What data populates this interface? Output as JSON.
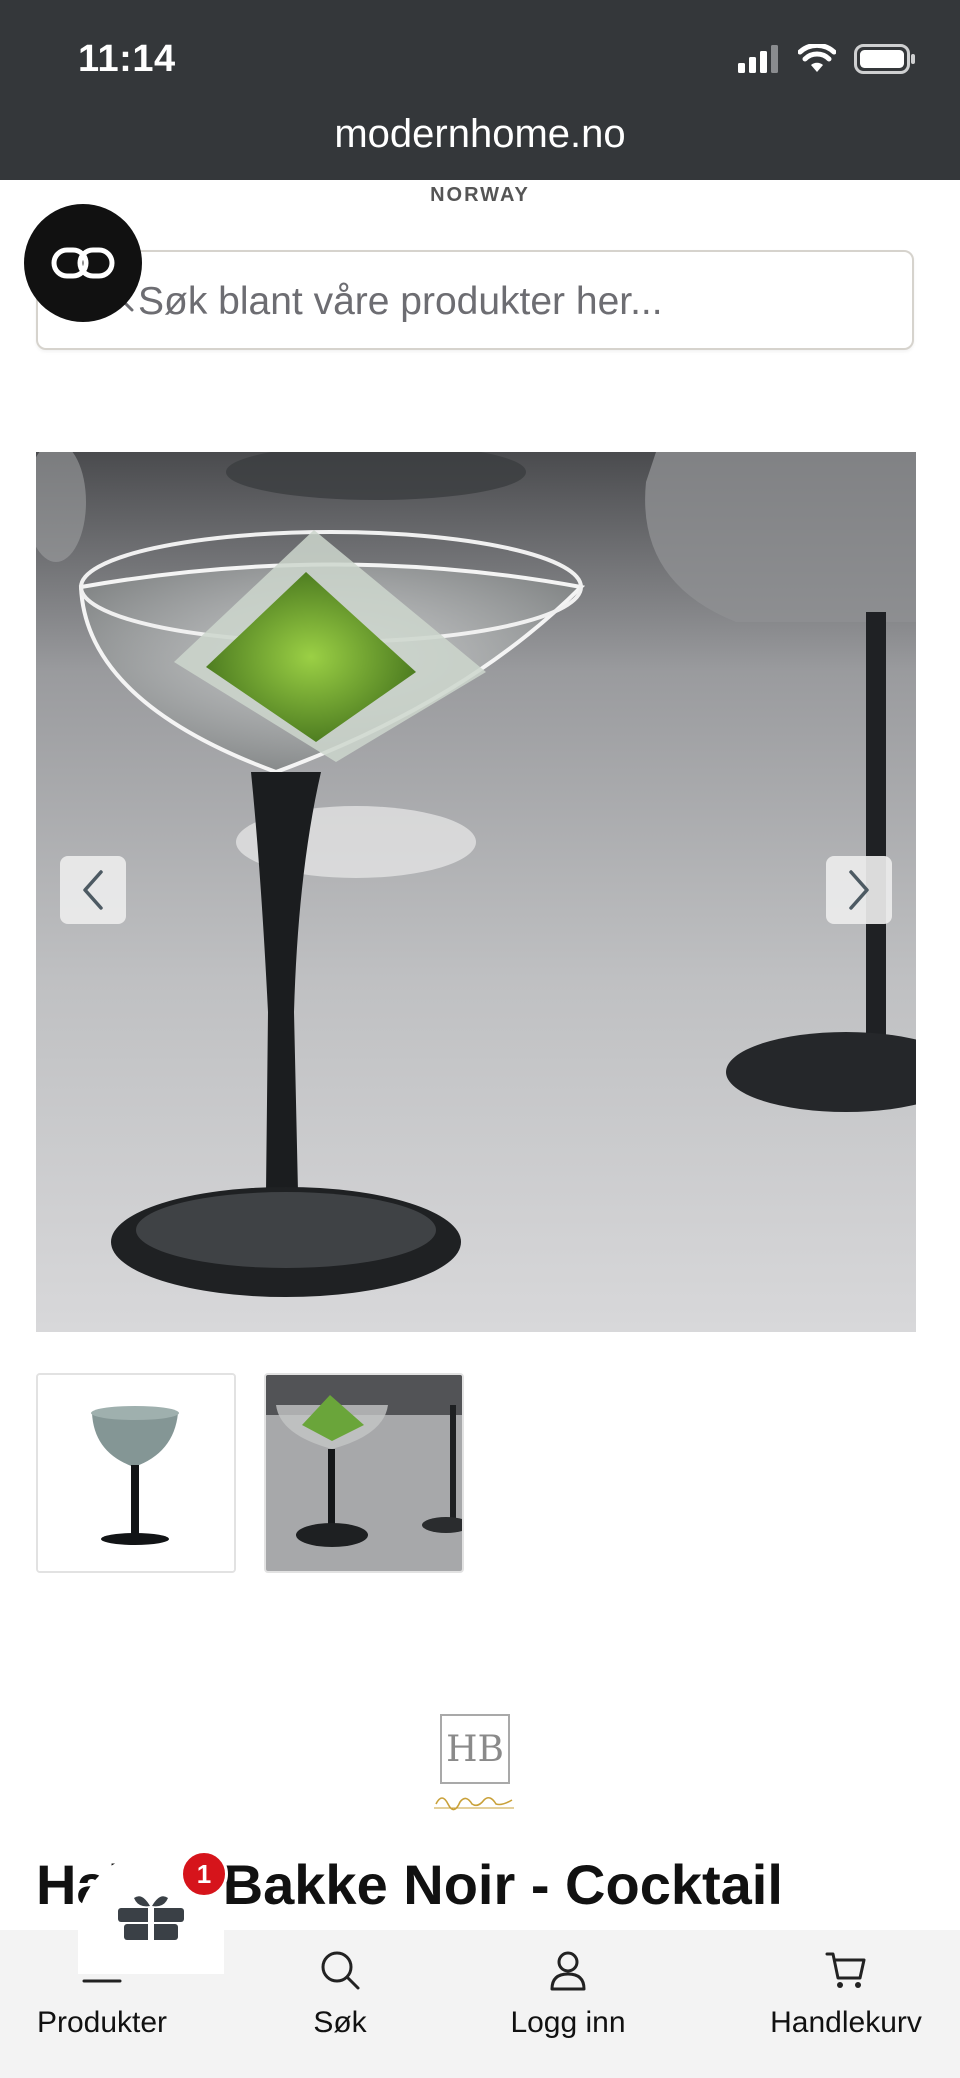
{
  "status_bar": {
    "time": "11:14"
  },
  "browser": {
    "url": "modernhome.no"
  },
  "header": {
    "brand_subtitle": "NORWAY"
  },
  "search": {
    "placeholder": "Søk blant våre produkter her..."
  },
  "product": {
    "brand_logo_text": "HB",
    "brand_signature": "Hakon Bakken",
    "title": "Hakon Bakke Noir - Cocktail",
    "thumbnails": [
      "cocktail-glass-studio",
      "cocktail-glass-lifestyle"
    ]
  },
  "gift": {
    "count": "1"
  },
  "bottom_nav": {
    "items": [
      {
        "label": "Produkter",
        "icon": "menu-icon"
      },
      {
        "label": "Søk",
        "icon": "search-icon"
      },
      {
        "label": "Logg inn",
        "icon": "user-icon"
      },
      {
        "label": "Handlekurv",
        "icon": "cart-icon"
      }
    ]
  },
  "colors": {
    "status_bar_bg": "#34373a",
    "nav_bg": "#f3f3f3",
    "badge_red": "#d6141b"
  }
}
